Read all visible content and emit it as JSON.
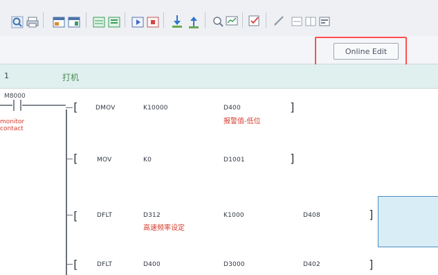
{
  "toolbar": {
    "online_edit_label": "Online Edit",
    "symbols": [
      "-|| ||-",
      "-||/ ||-",
      "-|↑| |↑|-",
      "-|↓| |↓|-",
      "< >",
      "( )",
      "[ ]"
    ]
  },
  "ladder": {
    "header_row_number": "1",
    "header_comment": "打机",
    "contact_device": "M8000",
    "contact_comment_line1": "monitor",
    "contact_comment_line2": "contact",
    "instructions": [
      {
        "op": "DMOV",
        "arg1": "K10000",
        "arg2": "D400",
        "comment2": "报警值-低位"
      },
      {
        "op": "MOV",
        "arg1": "K0",
        "arg2": "D1001"
      },
      {
        "op": "DFLT",
        "arg1": "D312",
        "arg2": "K1000",
        "arg3": "D408",
        "comment1": "高速频率设定"
      },
      {
        "op": "DFLT",
        "arg1": "D400",
        "arg2": "D3000",
        "arg3": "D402"
      }
    ]
  },
  "colors": {
    "toolbar_bg": "#eef0f4",
    "header_bg": "#dff0ef",
    "highlight_red": "#ff4d4d",
    "comment_red": "#d53b2d",
    "selection_blue": "#d9edf7"
  }
}
